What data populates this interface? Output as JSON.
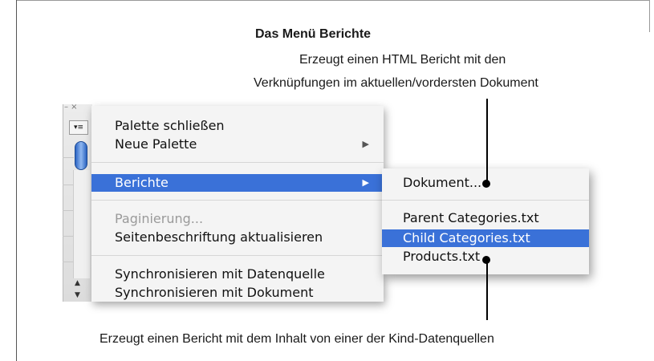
{
  "annotation": {
    "heading": "Das Menü Berichte",
    "top_description_line1": "Erzeugt einen HTML Bericht mit den",
    "top_description_line2": "Verknüpfungen im aktuellen/vordersten Dokument",
    "bottom_description": "Erzeugt einen Bericht mit dem Inhalt von einer der Kind-Datenquellen"
  },
  "palette": {
    "close_glyph": "– ×",
    "menu_button_glyph": "▾≡",
    "scroll_up_glyph": "▲",
    "scroll_down_glyph": "▼"
  },
  "menu": {
    "items": [
      {
        "label": "Palette schließen",
        "state": "enabled"
      },
      {
        "label": "Neue Palette",
        "state": "enabled",
        "submenu_arrow": "▶"
      },
      {
        "label": "Berichte",
        "state": "selected",
        "submenu_arrow": "▶"
      },
      {
        "label": "Paginierung...",
        "state": "disabled"
      },
      {
        "label": "Seitenbeschriftung aktualisieren",
        "state": "enabled"
      },
      {
        "label": "Synchronisieren mit Datenquelle",
        "state": "enabled"
      },
      {
        "label": "Synchronisieren mit Dokument",
        "state": "enabled"
      }
    ]
  },
  "submenu": {
    "items": [
      {
        "label": "Dokument...",
        "state": "enabled"
      },
      {
        "label": "Parent Categories.txt",
        "state": "enabled"
      },
      {
        "label": "Child Categories.txt",
        "state": "selected"
      },
      {
        "label": "Products.txt",
        "state": "enabled"
      }
    ]
  },
  "colors": {
    "selection": "#3a71d8",
    "menu_background": "#f4f4f4",
    "disabled_text": "#9a9a9a"
  }
}
